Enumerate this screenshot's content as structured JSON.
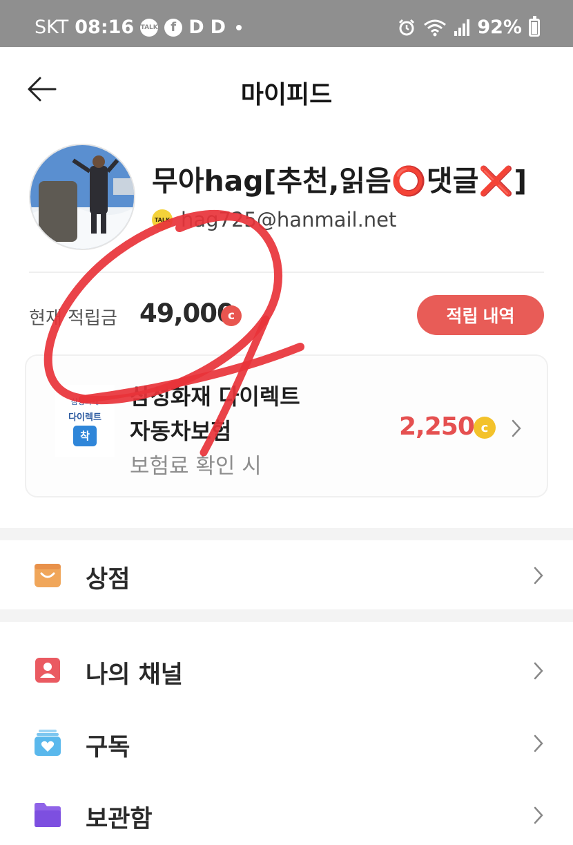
{
  "status_bar": {
    "carrier": "SKT",
    "time": "08:16",
    "notif_talk": "TALK",
    "notif_fb": "f",
    "notif_d1": "D",
    "notif_d2": "D",
    "wifi_badge": "6",
    "battery": "92%"
  },
  "header": {
    "title": "마이피드"
  },
  "profile": {
    "name": "무아hag[추천,읽음⭕댓글❌]",
    "login_badge": "TALK",
    "email": "hag725@hanmail.net"
  },
  "points": {
    "label": "현재 적립금",
    "value": "49,000",
    "coin_symbol": "c",
    "history_button": "적립 내역"
  },
  "ad": {
    "logo_line1": "삼성화재",
    "logo_line2": "다이렉트",
    "logo_badge": "착",
    "title_line1": "삼성화재 다이렉트",
    "title_line2": "자동차보험",
    "subtitle": "보험료 확인 시",
    "reward": "2,250",
    "coin_symbol": "c"
  },
  "menu": {
    "store": "상점",
    "my_channel": "나의 채널",
    "subscribe": "구독",
    "storage": "보관함"
  },
  "colors": {
    "status_bar": "#8f8f8f",
    "accent_red": "#e85c57",
    "reward_red": "#e55050",
    "coin_gold": "#f3c22b",
    "store_icon": "#f0a65a",
    "channel_icon": "#ea5a61",
    "subscribe_icon": "#5ab8ec",
    "storage_icon": "#8f63e8",
    "scribble": "#e8333a"
  },
  "icons": {
    "back": "arrow-left-icon",
    "store": "shopping-bag-icon",
    "channel": "person-card-icon",
    "subscribe": "heart-stack-icon",
    "storage": "folder-icon",
    "chevron": "chevron-right-icon"
  }
}
